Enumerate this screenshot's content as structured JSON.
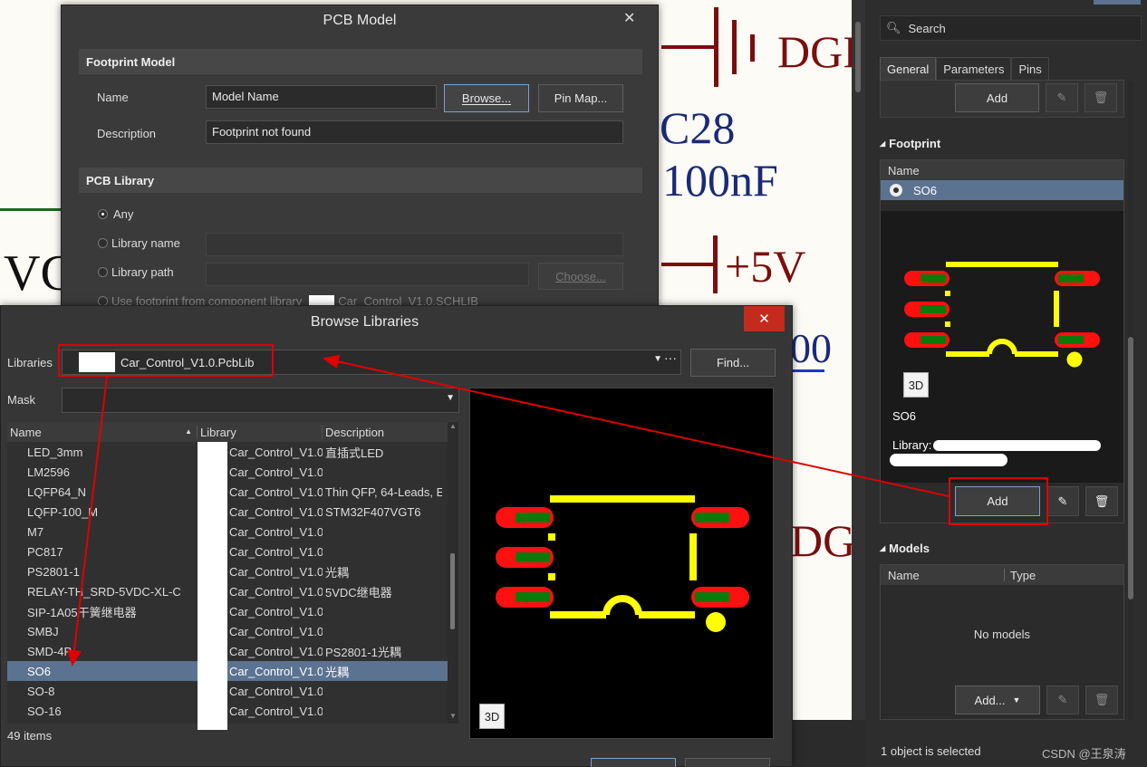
{
  "schematic": {
    "net_dgnd_top": "DGI",
    "cap_designator": "C28",
    "cap_value": "100nF",
    "net_5v": "+5V",
    "vcc_label": "VCC",
    "partial_00": "00",
    "net_dgnd_mid": "DGI"
  },
  "pcb_model": {
    "title": "PCB Model",
    "footprint_section": "Footprint Model",
    "name_label": "Name",
    "name_value": "Model Name",
    "browse_btn": "Browse...",
    "pinmap_btn": "Pin Map...",
    "description_label": "Description",
    "description_value": "Footprint not found",
    "library_section": "PCB Library",
    "opt_any": "Any",
    "opt_library_name": "Library name",
    "opt_library_path": "Library path",
    "choose_btn": "Choose...",
    "opt_use_footprint": "Use footprint from component library",
    "schlib_name": "Car_Control_V1.0.SCHLIB"
  },
  "browse": {
    "title": "Browse Libraries",
    "libraries_label": "Libraries",
    "library_value": "Car_Control_V1.0.PcbLib",
    "find_btn": "Find...",
    "mask_label": "Mask",
    "col_name": "Name",
    "col_library": "Library",
    "col_description": "Description",
    "rows": [
      {
        "name": "LED_3mm",
        "library": "Car_Control_V1.0",
        "description": "直插式LED"
      },
      {
        "name": "LM2596",
        "library": "Car_Control_V1.0",
        "description": ""
      },
      {
        "name": "LQFP64_N",
        "library": "Car_Control_V1.0",
        "description": "Thin QFP, 64-Leads, E"
      },
      {
        "name": "LQFP-100_M",
        "library": "Car_Control_V1.0",
        "description": "STM32F407VGT6"
      },
      {
        "name": "M7",
        "library": "Car_Control_V1.0",
        "description": ""
      },
      {
        "name": "PC817",
        "library": "Car_Control_V1.0",
        "description": ""
      },
      {
        "name": "PS2801-1",
        "library": "Car_Control_V1.0",
        "description": "光耦"
      },
      {
        "name": "RELAY-TH_SRD-5VDC-XL-C",
        "library": "Car_Control_V1.0",
        "description": "5VDC继电器"
      },
      {
        "name": "SIP-1A05干簧继电器",
        "library": "Car_Control_V1.0",
        "description": ""
      },
      {
        "name": "SMBJ",
        "library": "Car_Control_V1.0",
        "description": ""
      },
      {
        "name": "SMD-4P",
        "library": "Car_Control_V1.0",
        "description": "PS2801-1光耦"
      },
      {
        "name": "SO6",
        "library": "Car_Control_V1.0",
        "description": "光耦",
        "selected": true
      },
      {
        "name": "SO-8",
        "library": "Car_Control_V1.0",
        "description": ""
      },
      {
        "name": "SO-16",
        "library": "Car_Control_V1.0",
        "description": ""
      }
    ],
    "item_count": "49 items",
    "preview_3d": "3D"
  },
  "properties": {
    "search_placeholder": "Search",
    "tabs": [
      "General",
      "Parameters",
      "Pins"
    ],
    "add_btn_top": "Add",
    "footprint_section": "Footprint",
    "col_name": "Name",
    "footprint_item": "SO6",
    "preview_3d": "3D",
    "footprint_name": "SO6",
    "library_label": "Library:",
    "add_btn": "Add",
    "models_section": "Models",
    "models_col_name": "Name",
    "models_col_type": "Type",
    "no_models": "No models",
    "add_dropdown": "Add...",
    "status": "1 object is selected"
  },
  "watermark": "CSDN @王泉涛",
  "colors": {
    "pad_red": "#ff1010",
    "pad_green": "#0a7a0a",
    "silk_yellow": "#ffff00",
    "annotation_red": "#e00000",
    "selection_blue": "#5b7391"
  }
}
